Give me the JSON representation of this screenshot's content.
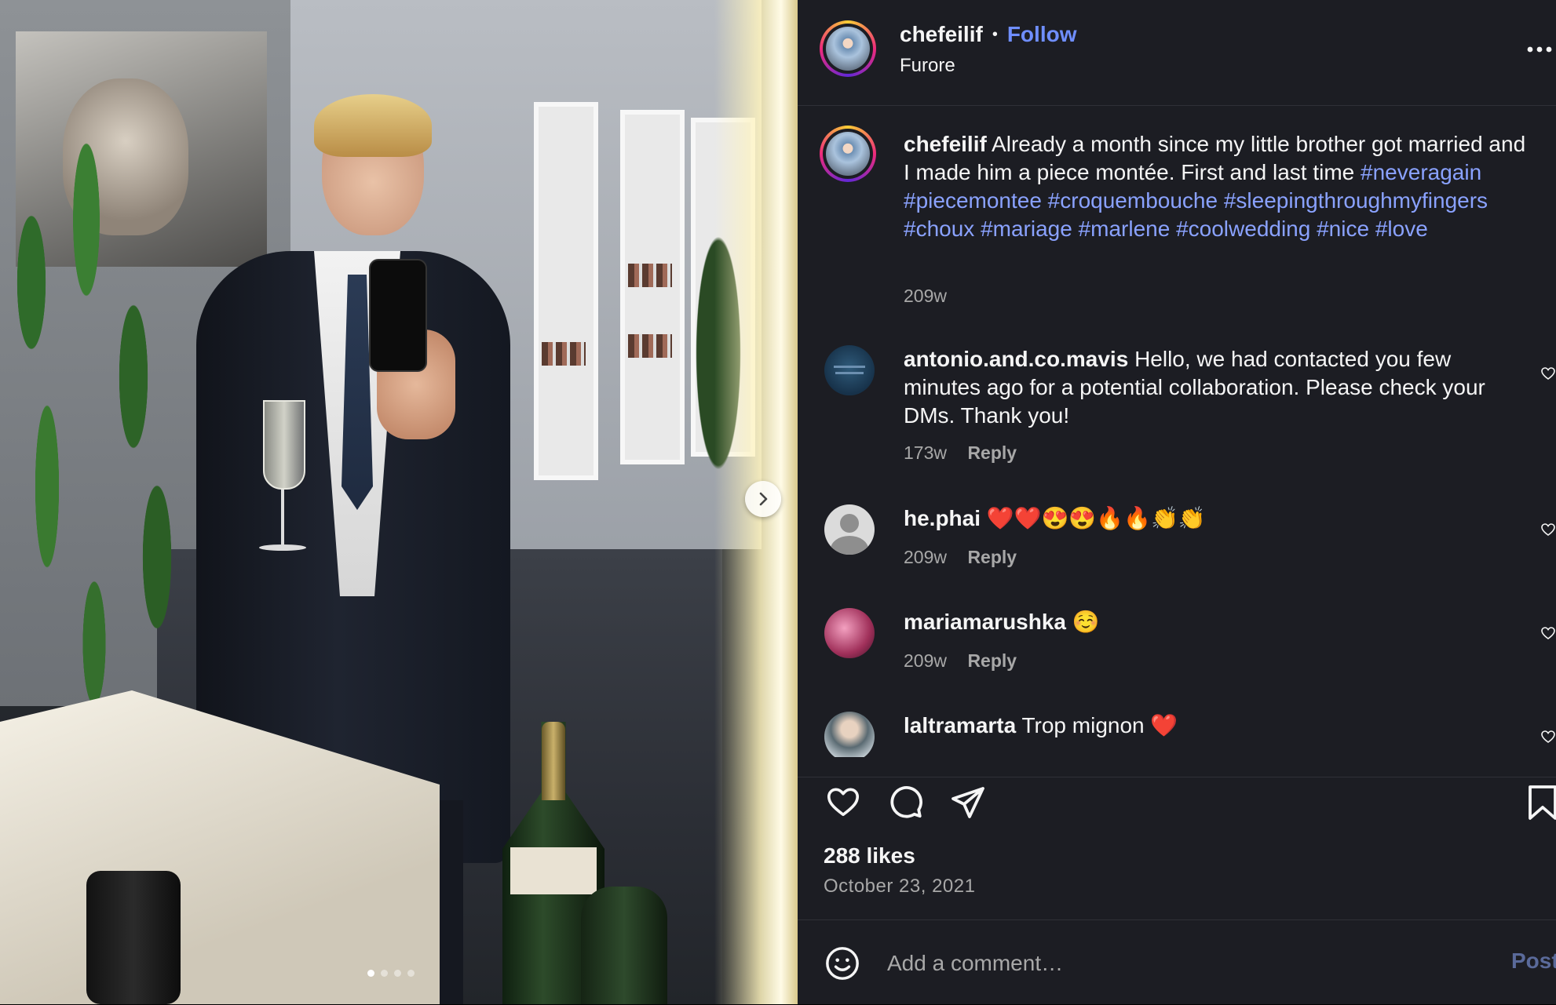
{
  "post": {
    "username": "chefeilif",
    "separator": "•",
    "follow_label": "Follow",
    "location": "Furore",
    "more_icon": "more-horizontal-icon",
    "image_nav_next_icon": "chevron-right-icon",
    "carousel_count": 4,
    "carousel_active_index": 0
  },
  "caption": {
    "username": "chefeilif",
    "text": "Already a month since my little brother got married and I made him a piece montée. First and last time",
    "hashtags": "#neveragain #piecemontee #croquembouche #sleepingthroughmyfingers #choux #mariage #marlene #coolwedding #nice #love",
    "age": "209w"
  },
  "comments": [
    {
      "username": "antonio.and.co.mavis",
      "text": "Hello, we had contacted you few minutes ago for a potential collaboration. Please check your DMs. Thank you!",
      "age": "173w",
      "reply_label": "Reply"
    },
    {
      "username": "he.phai",
      "text": "❤️❤️😍😍🔥🔥👏👏",
      "age": "209w",
      "reply_label": "Reply"
    },
    {
      "username": "mariamarushka",
      "text": "☺️",
      "age": "209w",
      "reply_label": "Reply"
    },
    {
      "username": "laltramarta",
      "text": "Trop mignon ❤️",
      "age": "",
      "reply_label": ""
    }
  ],
  "actions": {
    "like_icon": "heart-icon",
    "comment_icon": "comment-bubble-icon",
    "share_icon": "paper-plane-icon",
    "save_icon": "bookmark-icon"
  },
  "stats": {
    "likes": "288 likes",
    "date": "October 23, 2021"
  },
  "composer": {
    "emoji_icon": "emoji-smile-icon",
    "placeholder": "Add a comment…",
    "post_label": "Post"
  },
  "colors": {
    "panel_bg": "#1c1d23",
    "link_blue": "#6f8eff",
    "hashtag_blue": "#8aa2ff",
    "muted_text": "#a8a8a8"
  }
}
